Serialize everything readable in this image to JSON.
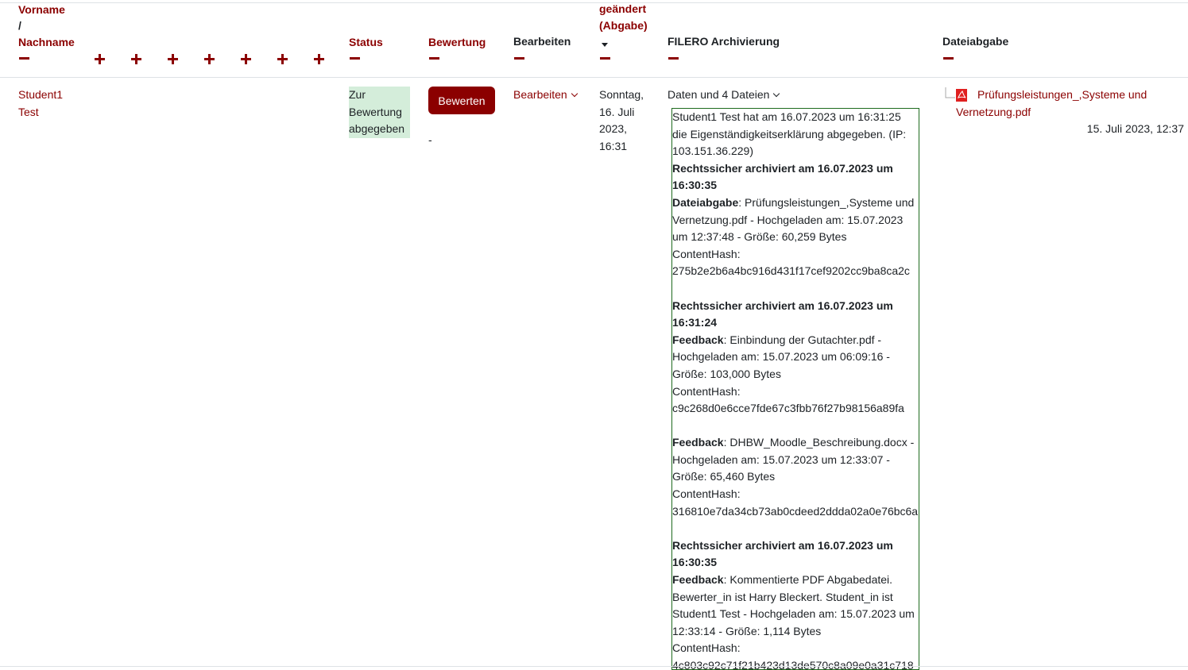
{
  "header": {
    "col_name_first": "Vorname",
    "col_name_sep": "/",
    "col_name_last": "Nachname",
    "col_status": "Status",
    "col_grade": "Bewertung",
    "col_edit": "Bearbeiten",
    "col_modified_line1": "geändert",
    "col_modified_line2": "(Abgabe)",
    "col_filero": "FILERO Archivierung",
    "col_fileupload": "Dateiabgabe"
  },
  "row": {
    "first_name": "Student1",
    "last_name": "Test",
    "status_lines": [
      "Zur",
      "Bewertung",
      "abgegeben"
    ],
    "grade_button": "Bewerten",
    "grade_value": "-",
    "edit_menu": "Bearbeiten",
    "modified_lines": [
      "Sonntag,",
      "16. Juli",
      "2023,",
      "16:31"
    ],
    "filero_toggle": "Daten und 4 Dateien",
    "filero_entries": [
      {
        "type": "text",
        "text": "Student1 Test hat am 16.07.2023 um 16:31:25 die Eigenständigkeitserklärung abgegeben. (IP: 103.151.36.229)"
      },
      {
        "type": "bold",
        "text": "Rechtssicher archiviert am 16.07.2023 um 16:30:35"
      },
      {
        "type": "labeled",
        "label": "Dateiabgabe",
        "text": ": Prüfungsleistungen_,Systeme und Vernetzung.pdf - Hochgeladen am: 15.07.2023 um 12:37:48 - Größe: 60,259 Bytes"
      },
      {
        "type": "text",
        "text": "ContentHash:"
      },
      {
        "type": "text",
        "text": "275b2e2b6a4bc916d431f17cef9202cc9ba8ca2c"
      },
      {
        "type": "gap"
      },
      {
        "type": "bold",
        "text": "Rechtssicher archiviert am 16.07.2023 um 16:31:24"
      },
      {
        "type": "labeled",
        "label": "Feedback",
        "text": ": Einbindung der Gutachter.pdf - Hochgeladen am: 15.07.2023 um 06:09:16 - Größe: 103,000 Bytes"
      },
      {
        "type": "text",
        "text": "ContentHash:"
      },
      {
        "type": "text",
        "text": "c9c268d0e6cce7fde67c3fbb76f27b98156a89fa"
      },
      {
        "type": "gap"
      },
      {
        "type": "labeled",
        "label": "Feedback",
        "text": ": DHBW_Moodle_Beschreibung.docx - Hochgeladen am: 15.07.2023 um 12:33:07 - Größe: 65,460 Bytes"
      },
      {
        "type": "text",
        "text": "ContentHash:"
      },
      {
        "type": "text",
        "text": "316810e7da34cb73ab0cdeed2ddda02a0e76bc6a"
      },
      {
        "type": "gap"
      },
      {
        "type": "bold",
        "text": "Rechtssicher archiviert am 16.07.2023 um 16:30:35"
      },
      {
        "type": "labeled",
        "label": "Feedback",
        "text": ": Kommentierte PDF Abgabedatei. Bewerter_in ist Harry Bleckert. Student_in ist Student1 Test - Hochgeladen am: 15.07.2023 um 12:33:14 - Größe: 1,114 Bytes"
      },
      {
        "type": "text",
        "text": "ContentHash:"
      },
      {
        "type": "text",
        "text": "4c803c92c71f21b423d13de570c8a09e0a31c718"
      }
    ],
    "file_link_line1": "Prüfungsleistungen_,Systeme und",
    "file_link_line2": "Vernetzung.pdf",
    "file_date": "15. Juli 2023, 12:37"
  },
  "icons": {
    "collapse": "minus-icon",
    "expand": "plus-icon",
    "sort": "sort-desc-icon",
    "dropdown": "chevron-down-icon",
    "file": "pdf-file-icon"
  },
  "colors": {
    "accent": "#8b0000",
    "status_bg": "#d4edda",
    "filero_border": "#1e6b1e"
  }
}
